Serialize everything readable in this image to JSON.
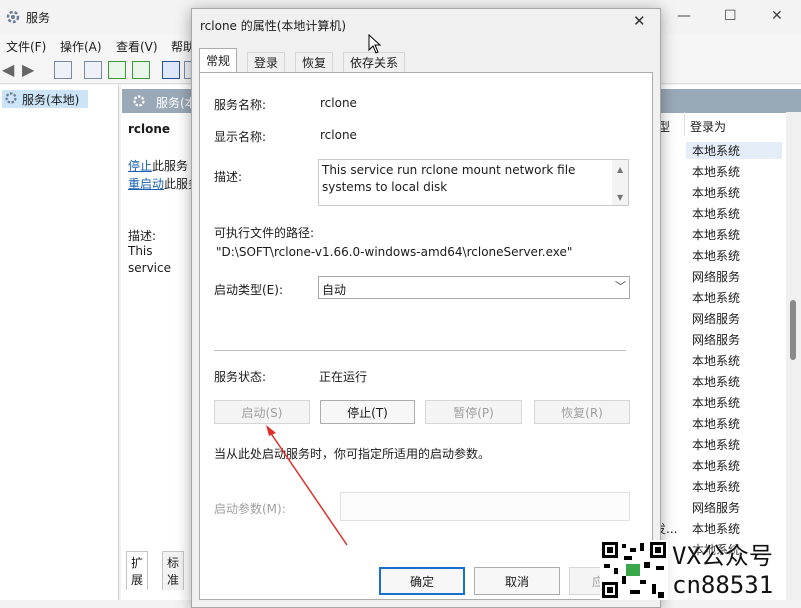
{
  "main_window": {
    "title": "服务",
    "controls": {
      "minimize": "—",
      "maximize": "☐",
      "close": "✕"
    },
    "menu": [
      "文件(F)",
      "操作(A)",
      "查看(V)",
      "帮助"
    ],
    "tree": {
      "item": "服务(本地)"
    },
    "panel": {
      "header": "服务(本",
      "service_name": "rclone",
      "stop_link": "停止",
      "stop_suffix": "此服务",
      "restart_link": "重启动",
      "restart_suffix": "此服务",
      "desc_label": "描述:",
      "desc_text": "This service run rclone mount network file"
    },
    "bottom_tabs": [
      "扩展",
      "标准"
    ],
    "columns": {
      "partial": "型",
      "logon_as": "登录为"
    },
    "fragment": "发...",
    "logon_rows": [
      "本地系统",
      "本地系统",
      "本地系统",
      "本地系统",
      "本地系统",
      "本地系统",
      "网络服务",
      "本地系统",
      "网络服务",
      "网络服务",
      "本地系统",
      "本地系统",
      "本地系统",
      "本地系统",
      "本地系统",
      "本地系统",
      "本地系统",
      "网络服务",
      "本地系统",
      "本地系统"
    ]
  },
  "dialog": {
    "title": "rclone 的属性(本地计算机)",
    "close": "✕",
    "tabs": [
      "常规",
      "登录",
      "恢复",
      "依存关系"
    ],
    "active_tab": "常规",
    "service_name_label": "服务名称:",
    "service_name": "rclone",
    "display_name_label": "显示名称:",
    "display_name": "rclone",
    "description_label": "描述:",
    "description": "This service run rclone mount network file systems to local disk",
    "exe_path_label": "可执行文件的路径:",
    "exe_path": "\"D:\\SOFT\\rclone-v1.66.0-windows-amd64\\rcloneServer.exe\"",
    "startup_type_label": "启动类型(E):",
    "startup_type": "自动",
    "status_label": "服务状态:",
    "status": "正在运行",
    "buttons": {
      "start": "启动(S)",
      "stop": "停止(T)",
      "pause": "暂停(P)",
      "resume": "恢复(R)"
    },
    "hint": "当从此处启动服务时，你可指定所适用的启动参数。",
    "params_label": "启动参数(M):",
    "params_value": "",
    "footer": {
      "ok": "确定",
      "cancel": "取消",
      "apply": "应"
    }
  },
  "watermark": {
    "line1": "VX公众号",
    "line2": "cn88531"
  },
  "colors": {
    "accent": "#1a6fce",
    "panel_header": "#9aa9b8",
    "selection": "#cce4f7",
    "annotation_arrow": "#e0302a"
  }
}
